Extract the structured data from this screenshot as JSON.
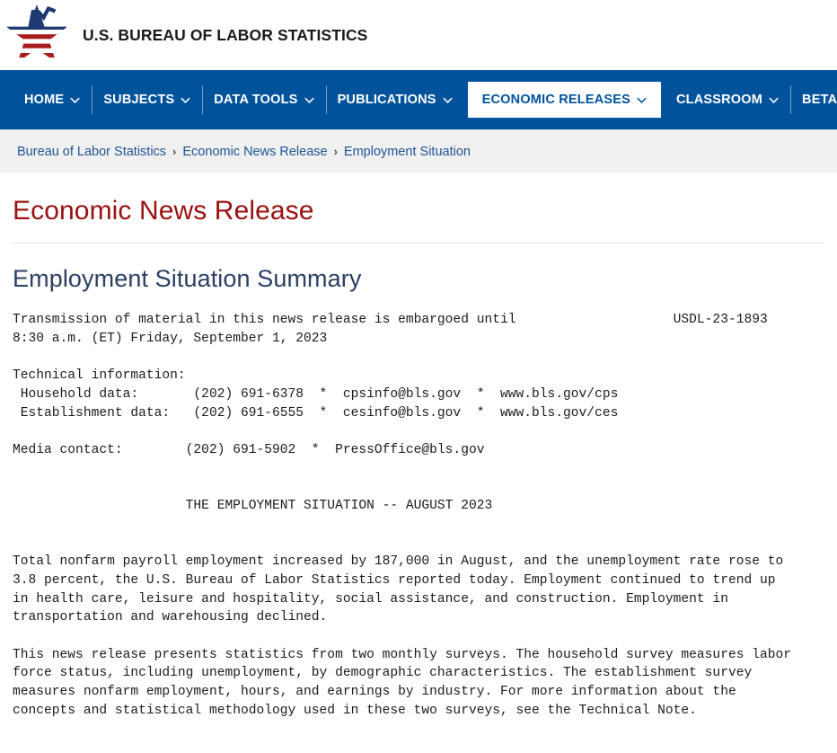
{
  "masthead": {
    "logo_icon": "bls-star-chart-logo",
    "agency_name": "U.S. BUREAU OF LABOR STATISTICS"
  },
  "nav": {
    "accent_color": "#00539b",
    "items": [
      {
        "label": "HOME",
        "icon": "chevron-down-icon",
        "active": false
      },
      {
        "label": "SUBJECTS",
        "icon": "chevron-down-icon",
        "active": false
      },
      {
        "label": "DATA TOOLS",
        "icon": "chevron-down-icon",
        "active": false
      },
      {
        "label": "PUBLICATIONS",
        "icon": "chevron-down-icon",
        "active": false
      },
      {
        "label": "ECONOMIC RELEASES",
        "icon": "chevron-down-icon",
        "active": true
      },
      {
        "label": "CLASSROOM",
        "icon": "chevron-down-icon",
        "active": false
      },
      {
        "label": "BETA",
        "icon": "chevron-down-icon",
        "active": false
      }
    ]
  },
  "breadcrumb": {
    "separator": "›",
    "items": [
      "Bureau of Labor Statistics",
      "Economic News Release",
      "Employment Situation"
    ]
  },
  "page": {
    "title": "Economic News Release",
    "title_color": "#9b1111",
    "release_heading": "Employment Situation Summary",
    "release_heading_color": "#2b3f63"
  },
  "release": {
    "embargo_line_1": "Transmission of material in this news release is embargoed until",
    "embargo_line_2": "8:30 a.m. (ET) Friday, September 1, 2023",
    "release_number": "USDL-23-1893",
    "technical_information_label": "Technical information:",
    "contacts": [
      {
        "label": "Household data:",
        "phone": "(202) 691-6378",
        "email": "cpsinfo@bls.gov",
        "url": "www.bls.gov/cps"
      },
      {
        "label": "Establishment data:",
        "phone": "(202) 691-6555",
        "email": "cesinfo@bls.gov",
        "url": "www.bls.gov/ces"
      }
    ],
    "media_contact_label": "Media contact:",
    "media_contact_phone": "(202) 691-5902",
    "media_contact_email": "PressOffice@bls.gov",
    "headline": "THE EMPLOYMENT SITUATION -- AUGUST 2023",
    "paragraph_1": "Total nonfarm payroll employment increased by 187,000 in August, and the unemployment rate rose to\n3.8 percent, the U.S. Bureau of Labor Statistics reported today. Employment continued to trend up\nin health care, leisure and hospitality, social assistance, and construction. Employment in\ntransportation and warehousing declined.",
    "paragraph_2": "This news release presents statistics from two monthly surveys. The household survey measures labor\nforce status, including unemployment, by demographic characteristics. The establishment survey\nmeasures nonfarm employment, hours, and earnings by industry. For more information about the\nconcepts and statistical methodology used in these two surveys, see the Technical Note.",
    "body_block": "Transmission of material in this news release is embargoed until                    USDL-23-1893\n8:30 a.m. (ET) Friday, September 1, 2023\n\nTechnical information:\n Household data:       (202) 691-6378  *  cpsinfo@bls.gov  *  www.bls.gov/cps\n Establishment data:   (202) 691-6555  *  cesinfo@bls.gov  *  www.bls.gov/ces\n\nMedia contact:        (202) 691-5902  *  PressOffice@bls.gov\n\n\n                      THE EMPLOYMENT SITUATION -- AUGUST 2023\n\n\nTotal nonfarm payroll employment increased by 187,000 in August, and the unemployment rate rose to\n3.8 percent, the U.S. Bureau of Labor Statistics reported today. Employment continued to trend up\nin health care, leisure and hospitality, social assistance, and construction. Employment in\ntransportation and warehousing declined.\n\nThis news release presents statistics from two monthly surveys. The household survey measures labor\nforce status, including unemployment, by demographic characteristics. The establishment survey\nmeasures nonfarm employment, hours, and earnings by industry. For more information about the\nconcepts and statistical methodology used in these two surveys, see the Technical Note."
  }
}
